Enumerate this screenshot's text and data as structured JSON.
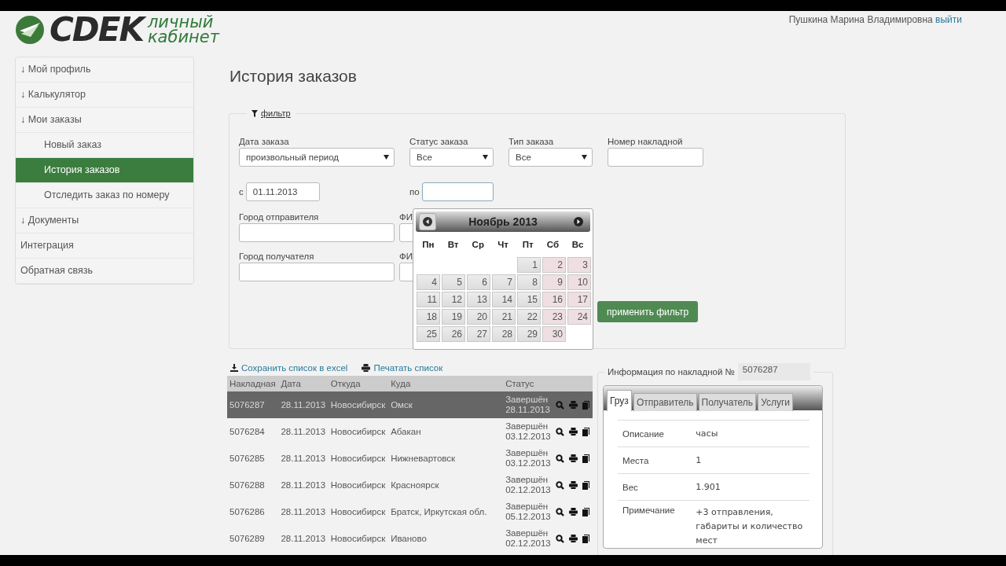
{
  "header": {
    "logo_text": "CDEK",
    "logo_caption_1": "личный",
    "logo_caption_2": "кабинет",
    "user_name": "Пушкина Марина Владимировна",
    "logout": "выйти"
  },
  "sidebar": {
    "items": [
      {
        "label": "↓ Мой профиль",
        "selected": false
      },
      {
        "label": "↓ Калькулятор",
        "selected": false
      },
      {
        "label": "↓ Мои заказы",
        "selected": false,
        "children": [
          {
            "label": "Новый заказ",
            "selected": false
          },
          {
            "label": "История заказов",
            "selected": true
          },
          {
            "label": "Отследить заказ по номеру",
            "selected": false
          }
        ]
      },
      {
        "label": "↓ Документы",
        "selected": false
      },
      {
        "label": "Интеграция",
        "selected": false
      },
      {
        "label": "Обратная связь",
        "selected": false
      }
    ]
  },
  "page_title": "История заказов",
  "filter": {
    "legend": "фильтр",
    "order_date": {
      "label": "Дата заказа",
      "value": "произвольный период"
    },
    "order_status": {
      "label": "Статус заказа",
      "value": "Все"
    },
    "order_type": {
      "label": "Тип заказа",
      "value": "Все"
    },
    "waybill_number": {
      "label": "Номер накладной"
    },
    "from": {
      "label": "с",
      "value": "01.11.2013"
    },
    "to": {
      "label": "по"
    },
    "sender_city": {
      "label": "Город отправителя"
    },
    "sender_name": {
      "label": "ФИ"
    },
    "recipient_city": {
      "label": "Город получателя"
    },
    "recipient_name": {
      "label": "ФИ"
    },
    "apply_button": "применить фильтр"
  },
  "datepicker": {
    "month": "Ноябрь 2013",
    "weekdays": [
      "Пн",
      "Вт",
      "Ср",
      "Чт",
      "Пт",
      "Сб",
      "Вс"
    ],
    "weeks": [
      [
        {
          "label": "1",
          "weekend": false
        },
        {
          "label": "2",
          "weekend": true
        },
        {
          "label": "3",
          "weekend": true
        }
      ],
      [
        {
          "label": "4",
          "weekend": false
        },
        {
          "label": "5",
          "weekend": false
        },
        {
          "label": "6",
          "weekend": false
        },
        {
          "label": "7",
          "weekend": false
        },
        {
          "label": "8",
          "weekend": false
        },
        {
          "label": "9",
          "weekend": true
        },
        {
          "label": "10",
          "weekend": true
        }
      ],
      [
        {
          "label": "11",
          "weekend": false
        },
        {
          "label": "12",
          "weekend": false
        },
        {
          "label": "13",
          "weekend": false
        },
        {
          "label": "14",
          "weekend": false
        },
        {
          "label": "15",
          "weekend": false
        },
        {
          "label": "16",
          "weekend": true
        },
        {
          "label": "17",
          "weekend": true
        }
      ],
      [
        {
          "label": "18",
          "weekend": false
        },
        {
          "label": "19",
          "weekend": false
        },
        {
          "label": "20",
          "weekend": false
        },
        {
          "label": "21",
          "weekend": false
        },
        {
          "label": "22",
          "weekend": false
        },
        {
          "label": "23",
          "weekend": true
        },
        {
          "label": "24",
          "weekend": true
        }
      ],
      [
        {
          "label": "25",
          "weekend": false
        },
        {
          "label": "26",
          "weekend": false
        },
        {
          "label": "27",
          "weekend": false
        },
        {
          "label": "28",
          "weekend": false
        },
        {
          "label": "29",
          "weekend": false
        },
        {
          "label": "30",
          "weekend": true
        }
      ]
    ]
  },
  "list_actions": {
    "save_excel": "Сохранить список в excel",
    "print": "Печатать список"
  },
  "table": {
    "columns": [
      "Накладная",
      "Дата",
      "Откуда",
      "Куда",
      "Статус"
    ],
    "rows": [
      {
        "waybill": "5076287",
        "date": "28.11.2013",
        "from": "Новосибирск",
        "to": "Омск",
        "status": "Завершён",
        "status_date": "28.11.2013",
        "selected": true
      },
      {
        "waybill": "5076284",
        "date": "28.11.2013",
        "from": "Новосибирск",
        "to": "Абакан",
        "status": "Завершён",
        "status_date": "03.12.2013",
        "selected": false
      },
      {
        "waybill": "5076285",
        "date": "28.11.2013",
        "from": "Новосибирск",
        "to": "Нижневартовск",
        "status": "Завершён",
        "status_date": "03.12.2013",
        "selected": false
      },
      {
        "waybill": "5076288",
        "date": "28.11.2013",
        "from": "Новосибирск",
        "to": "Красноярск",
        "status": "Завершён",
        "status_date": "02.12.2013",
        "selected": false
      },
      {
        "waybill": "5076286",
        "date": "28.11.2013",
        "from": "Новосибирск",
        "to": "Братск, Иркутская обл.",
        "status": "Завершён",
        "status_date": "05.12.2013",
        "selected": false
      },
      {
        "waybill": "5076289",
        "date": "28.11.2013",
        "from": "Новосибирск",
        "to": "Иваново",
        "status": "Завершён",
        "status_date": "02.12.2013",
        "selected": false
      }
    ]
  },
  "details": {
    "legend": "Информация по накладной №",
    "waybill": "5076287",
    "tabs": [
      {
        "label": "Груз",
        "selected": true
      },
      {
        "label": "Отправитель",
        "selected": false
      },
      {
        "label": "Получатель",
        "selected": false
      },
      {
        "label": "Услуги",
        "selected": false
      }
    ],
    "rows": [
      {
        "label": "Описание",
        "value": "часы"
      },
      {
        "label": "Места",
        "value": "1"
      },
      {
        "label": "Вес",
        "value": "1.901"
      },
      {
        "label": "Примечание",
        "value": "+3 отправления, габариты и количество мест"
      }
    ]
  }
}
